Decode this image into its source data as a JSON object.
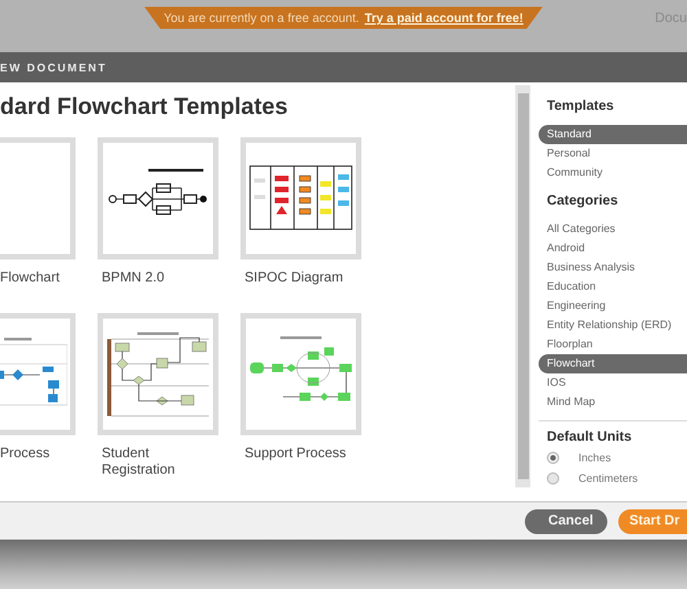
{
  "banner": {
    "text": "You are currently on a free account.",
    "link": "Try a paid account for free!"
  },
  "top_right_text": "Docu",
  "dialog": {
    "title": "EW DOCUMENT"
  },
  "heading": "dard Flowchart Templates",
  "templates": [
    {
      "title": "Flowchart",
      "kind": "blank"
    },
    {
      "title": "BPMN 2.0",
      "kind": "bpmn"
    },
    {
      "title": "SIPOC Diagram",
      "kind": "sipoc"
    },
    {
      "title": "Process",
      "kind": "sales"
    },
    {
      "title": "Student Registration",
      "kind": "student"
    },
    {
      "title": "Support Process",
      "kind": "support"
    }
  ],
  "sidebar": {
    "templates_heading": "Templates",
    "sources": [
      {
        "label": "Standard",
        "selected": true
      },
      {
        "label": "Personal",
        "selected": false
      },
      {
        "label": "Community",
        "selected": false
      }
    ],
    "categories_heading": "Categories",
    "categories": [
      {
        "label": "All Categories",
        "selected": false
      },
      {
        "label": "Android",
        "selected": false
      },
      {
        "label": "Business Analysis",
        "selected": false
      },
      {
        "label": "Education",
        "selected": false
      },
      {
        "label": "Engineering",
        "selected": false
      },
      {
        "label": "Entity Relationship (ERD)",
        "selected": false
      },
      {
        "label": "Floorplan",
        "selected": false
      },
      {
        "label": "Flowchart",
        "selected": true
      },
      {
        "label": "IOS",
        "selected": false
      },
      {
        "label": "Mind Map",
        "selected": false
      }
    ],
    "units": {
      "heading": "Default Units",
      "options": [
        {
          "label": "Inches",
          "selected": true
        },
        {
          "label": "Centimeters",
          "selected": false
        }
      ]
    }
  },
  "buttons": [
    {
      "label": "Cancel",
      "kind": "cancel"
    },
    {
      "label": "Start Dr",
      "kind": "primary"
    }
  ]
}
